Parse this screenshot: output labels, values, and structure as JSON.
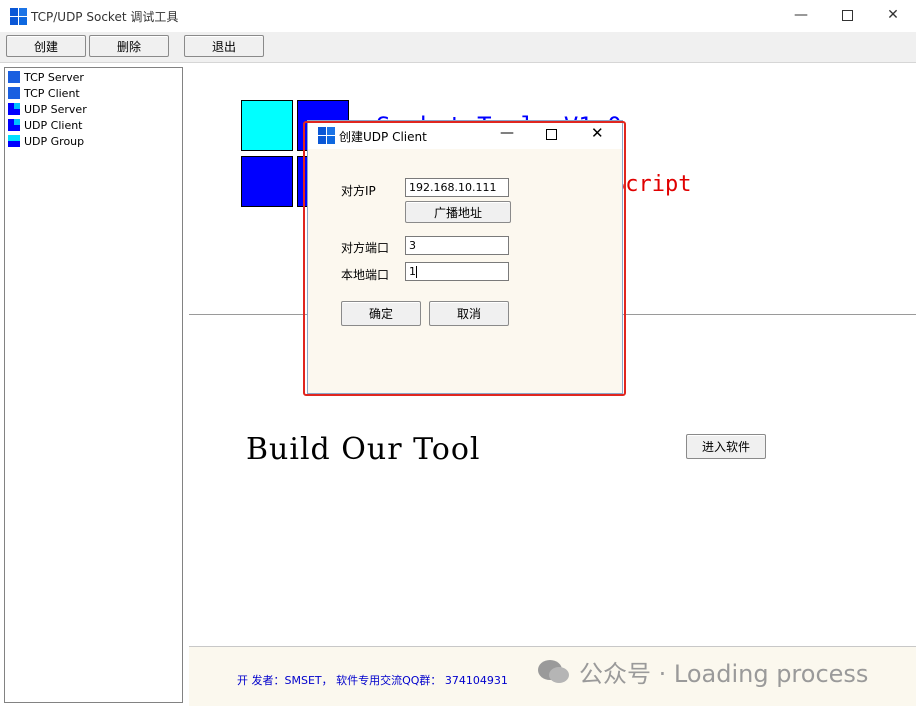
{
  "window": {
    "title": "TCP/UDP Socket 调试工具"
  },
  "toolbar": {
    "create": "创建",
    "delete": "删除",
    "exit": "退出"
  },
  "sidebar": {
    "items": [
      {
        "label": "TCP Server"
      },
      {
        "label": "TCP Client"
      },
      {
        "label": "UDP Server"
      },
      {
        "label": "UDP Client"
      },
      {
        "label": "UDP Group"
      }
    ]
  },
  "main": {
    "banner_line1": "Socket Tools V1.0",
    "banner_line2": "Script",
    "tagline": "Build Our Tool",
    "enter_button": "进入软件"
  },
  "footer": {
    "text": "开 发者：SMSET， 软件专用交流QQ群： 374104931"
  },
  "watermark": {
    "text": "公众号 · Loading process"
  },
  "dialog": {
    "title": "创建UDP Client",
    "remote_ip_label": "对方IP",
    "remote_ip_value": "192.168.10.111",
    "broadcast_button": "广播地址",
    "remote_port_label": "对方端口",
    "remote_port_value": "3",
    "local_port_label": "本地端口",
    "local_port_value": "1",
    "ok_button": "确定",
    "cancel_button": "取消"
  },
  "colors": {
    "brand_blue": "#0000ff",
    "cyan": "#00ffff",
    "highlight_red": "#e0261f",
    "banner_red": "#e00000"
  }
}
